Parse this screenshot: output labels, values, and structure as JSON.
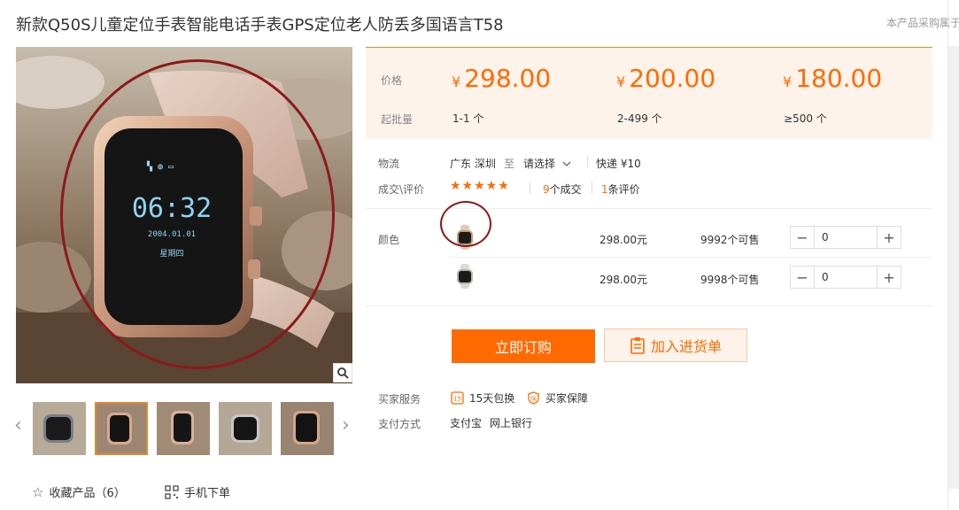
{
  "title": "新款Q50S儿童定位手表智能电话手表GPS定位老人防丢多国语言T58",
  "top_note": "本产品采购属于",
  "price_table": {
    "price_label": "价格",
    "batch_label": "起批量",
    "currency": "¥",
    "tiers": [
      {
        "price": "298.00",
        "qty": "1-1 个"
      },
      {
        "price": "200.00",
        "qty": "2-499 个"
      },
      {
        "price": "180.00",
        "qty": "≥500 个"
      }
    ]
  },
  "logistics": {
    "label": "物流",
    "from": "广东 深圳",
    "to_word": "至",
    "select": "请选择",
    "express": "快递 ¥10"
  },
  "deals": {
    "label": "成交\\评价",
    "stars": "★★★★★",
    "count": "9",
    "count_suffix": "个成交",
    "reviews": "1",
    "reviews_suffix": "条评价"
  },
  "color_label": "颜色",
  "skus": [
    {
      "price": "298.00元",
      "stock": "9992个可售",
      "qty": "0"
    },
    {
      "price": "298.00元",
      "stock": "9998个可售",
      "qty": "0"
    }
  ],
  "buttons": {
    "buy": "立即订购",
    "cart": "加入进货单"
  },
  "service": {
    "label": "买家服务",
    "items": [
      "15天包换",
      "买家保障"
    ]
  },
  "payment": {
    "label": "支付方式",
    "items": [
      "支付宝",
      "网上银行"
    ]
  },
  "footer": {
    "favorite": "收藏产品（6）",
    "mobile": "手机下单"
  },
  "watch_screen": {
    "time": "06:32",
    "date": "2004.01.01",
    "weekday": "星期四"
  },
  "colors": {
    "accent": "#ff6a00",
    "price_bg": "#fdf3ea",
    "annotation_circle": "#8b1a1a"
  }
}
